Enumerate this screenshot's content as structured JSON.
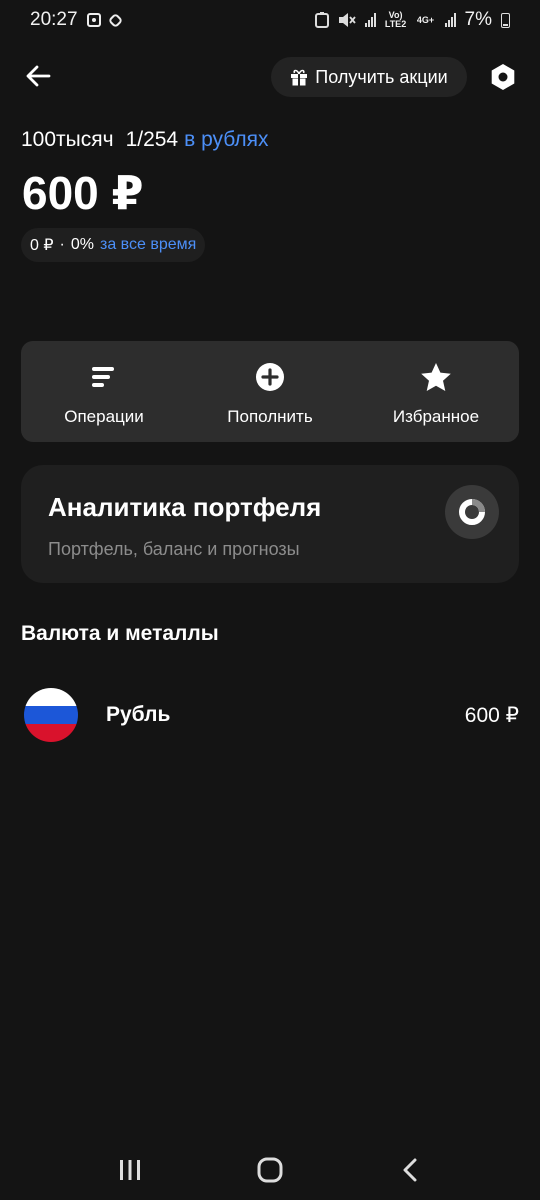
{
  "status_bar": {
    "time": "20:27",
    "network_label": "Vo) LTE2",
    "network_label_2": "4G+",
    "battery": "7%"
  },
  "top_bar": {
    "promo_label": "Получить акции"
  },
  "portfolio": {
    "name": "100тысяч",
    "index": "1/254",
    "currency_link": "в рублях",
    "total_value": "600 ₽",
    "change_amount": "0 ₽",
    "change_separator": "·",
    "change_percent": "0%",
    "change_period": "за все время"
  },
  "actions": [
    {
      "label": "Операции",
      "icon": "operations-icon"
    },
    {
      "label": "Пополнить",
      "icon": "plus-circle-icon"
    },
    {
      "label": "Избранное",
      "icon": "star-icon"
    }
  ],
  "analytics": {
    "title": "Аналитика портфеля",
    "subtitle": "Портфель, баланс и прогнозы",
    "icon": "donut-chart-icon"
  },
  "section": {
    "title": "Валюта и металлы"
  },
  "assets": [
    {
      "name": "Рубль",
      "value": "600 ₽",
      "flag_colors": [
        "#ffffff",
        "#1c57d8",
        "#d9122c"
      ]
    }
  ],
  "nav": {
    "icons": [
      "recent-apps-icon",
      "home-icon",
      "back-icon"
    ]
  },
  "colors": {
    "background": "#141414",
    "accent": "#4c8ff7",
    "card": "#2d2d2d"
  }
}
